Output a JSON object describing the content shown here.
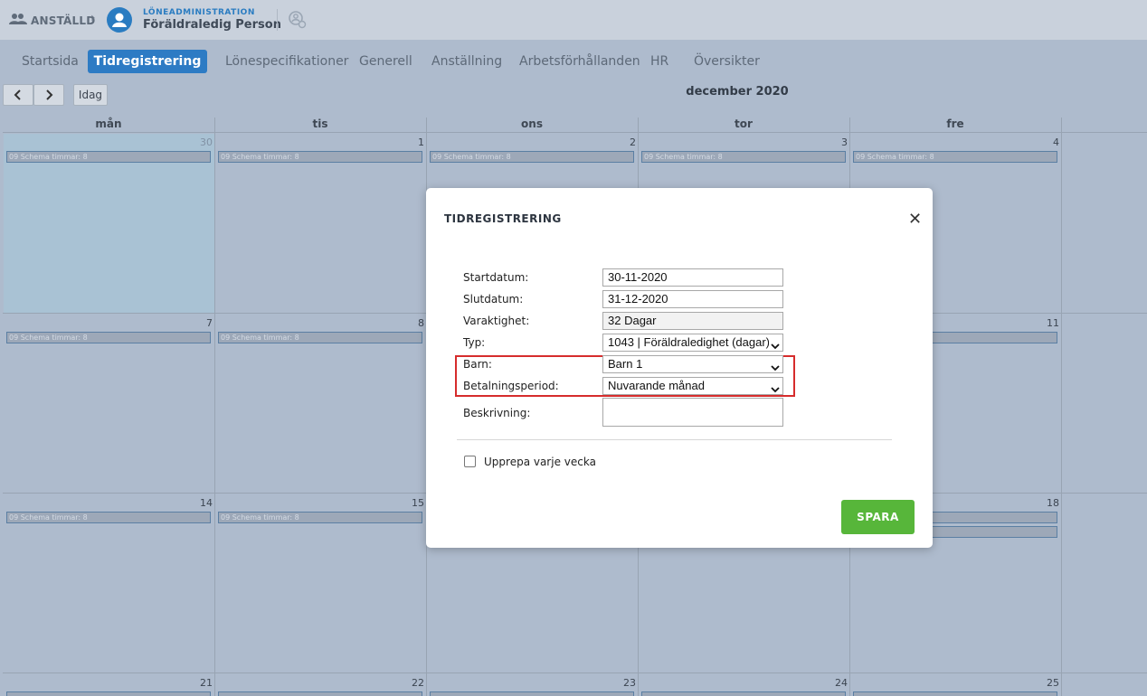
{
  "header": {
    "crumb_label": "ANSTÄLLD",
    "org_label": "LÖNEADMINISTRATION",
    "person_name": "Föräldraledig Person"
  },
  "tabs": [
    "Startsida",
    "Tidregistrering",
    "Lönespecifikationer",
    "Generell",
    "Anställning",
    "Arbetsförhållanden",
    "HR",
    "Översikter"
  ],
  "active_tab": "Tidregistrering",
  "toolbar": {
    "today_label": "Idag",
    "month_label": "december 2020"
  },
  "calendar": {
    "weekdays": [
      "mån",
      "tis",
      "ons",
      "tor",
      "fre"
    ],
    "weeks": [
      [
        "30",
        "1",
        "2",
        "3",
        "4"
      ],
      [
        "7",
        "8",
        "",
        "",
        "11"
      ],
      [
        "14",
        "15",
        "",
        "",
        "18"
      ],
      [
        "21",
        "22",
        "23",
        "24",
        "25"
      ]
    ],
    "event_label": "09 Schema timmar: 8",
    "partial_event_label": "8"
  },
  "modal": {
    "title": "TIDREGISTRERING",
    "fields": {
      "start_label": "Startdatum:",
      "start_value": "30-11-2020",
      "end_label": "Slutdatum:",
      "end_value": "31-12-2020",
      "duration_label": "Varaktighet:",
      "duration_value": "32 Dagar",
      "type_label": "Typ:",
      "type_value": "1043 | Föräldraledighet (dagar)",
      "child_label": "Barn:",
      "child_value": "Barn 1",
      "payperiod_label": "Betalningsperiod:",
      "payperiod_value": "Nuvarande månad",
      "desc_label": "Beskrivning:"
    },
    "repeat_label": "Upprepa varje vecka",
    "save_label": "SPARA"
  },
  "colors": {
    "accent": "#2d7bc4",
    "save": "#57b63a",
    "highlight": "#d62c2c"
  }
}
